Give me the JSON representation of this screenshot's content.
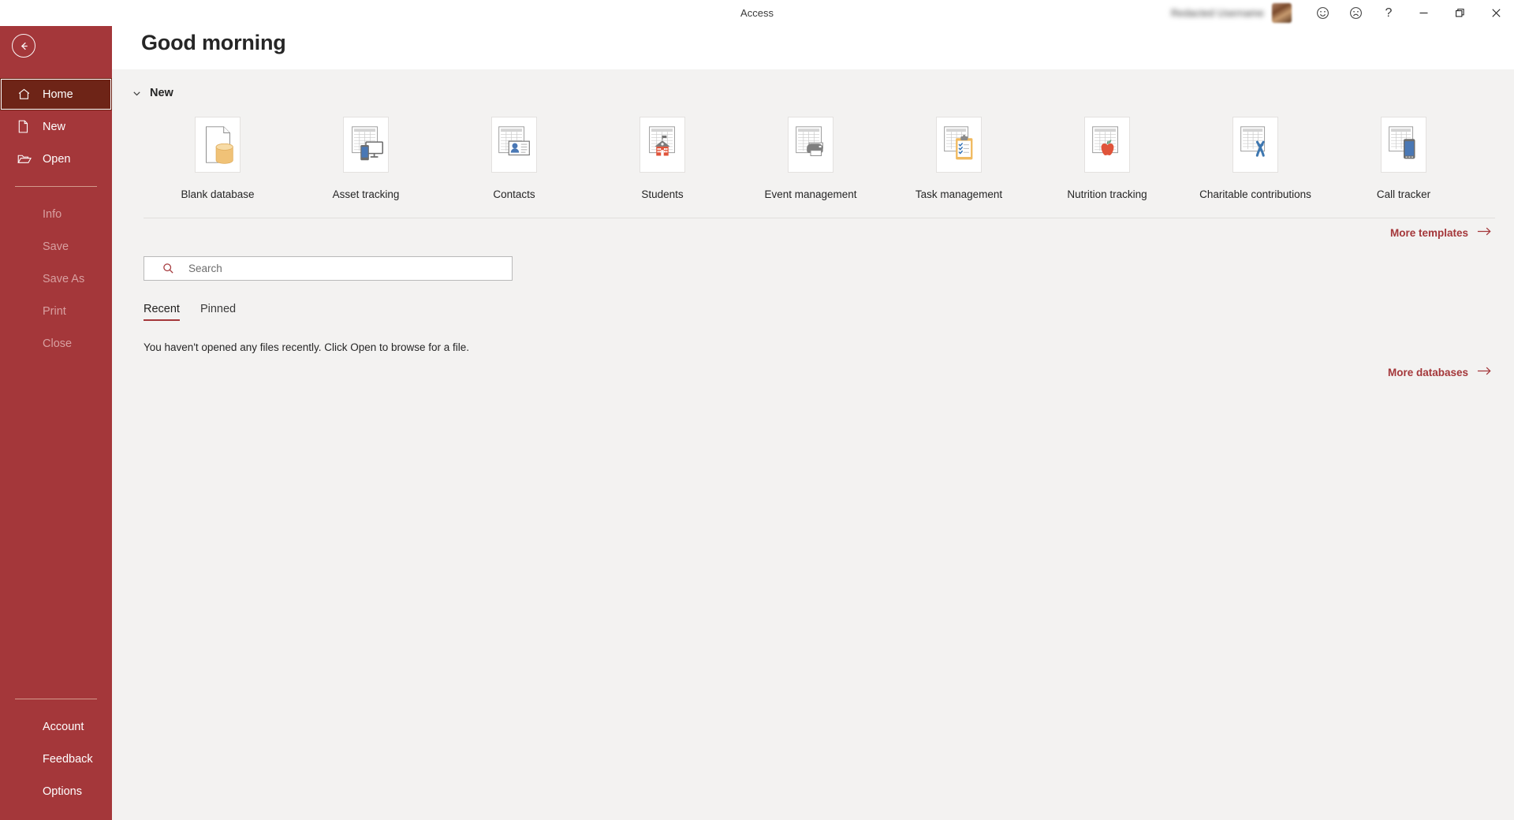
{
  "titlebar": {
    "title": "Access",
    "account_name": "",
    "icons": [
      {
        "name": "smiley-face-icon",
        "label": "Send a Smile"
      },
      {
        "name": "frowny-face-icon",
        "label": "Send a Frown"
      },
      {
        "name": "help-icon",
        "label": "?"
      }
    ],
    "window_controls": [
      {
        "name": "minimize-button",
        "label": "Minimize"
      },
      {
        "name": "restore-button",
        "label": "Restore Down"
      },
      {
        "name": "close-button",
        "label": "Close"
      }
    ]
  },
  "sidebar": {
    "back_label": "Back",
    "primary": [
      {
        "label": "Home",
        "icon": "home-icon",
        "selected": true,
        "disabled": false
      },
      {
        "label": "New",
        "icon": "new-document-icon",
        "selected": false,
        "disabled": false
      },
      {
        "label": "Open",
        "icon": "open-folder-icon",
        "selected": false,
        "disabled": false
      }
    ],
    "secondary": [
      {
        "label": "Info",
        "disabled": true
      },
      {
        "label": "Save",
        "disabled": true
      },
      {
        "label": "Save As",
        "disabled": true
      },
      {
        "label": "Print",
        "disabled": true
      },
      {
        "label": "Close",
        "disabled": true
      }
    ],
    "footer": [
      {
        "label": "Account",
        "disabled": false
      },
      {
        "label": "Feedback",
        "disabled": false
      },
      {
        "label": "Options",
        "disabled": false
      }
    ]
  },
  "main": {
    "greeting": "Good morning",
    "new_section": {
      "title": "New",
      "chevron": "chevron-down-icon",
      "templates": [
        {
          "label": "Blank database",
          "icon": "blank-database-icon"
        },
        {
          "label": "Asset tracking",
          "icon": "asset-tracking-icon"
        },
        {
          "label": "Contacts",
          "icon": "contacts-icon"
        },
        {
          "label": "Students",
          "icon": "students-icon"
        },
        {
          "label": "Event management",
          "icon": "event-management-icon"
        },
        {
          "label": "Task management",
          "icon": "task-management-icon"
        },
        {
          "label": "Nutrition tracking",
          "icon": "nutrition-tracking-icon"
        },
        {
          "label": "Charitable contributions",
          "icon": "charitable-contributions-icon"
        },
        {
          "label": "Call tracker",
          "icon": "call-tracker-icon"
        }
      ],
      "more_link": "More templates"
    },
    "search": {
      "placeholder": "Search",
      "value": "",
      "icon": "search-icon"
    },
    "tabs": [
      {
        "label": "Recent",
        "active": true
      },
      {
        "label": "Pinned",
        "active": false
      }
    ],
    "empty_message": "You haven't opened any files recently. Click Open to browse for a file.",
    "more_databases_link": "More databases"
  },
  "colors": {
    "accent": "#a4373a",
    "accent_selected": "#6e2417",
    "content_bg": "#f3f2f1",
    "header_bg": "#ffffff",
    "text": "#262626"
  }
}
